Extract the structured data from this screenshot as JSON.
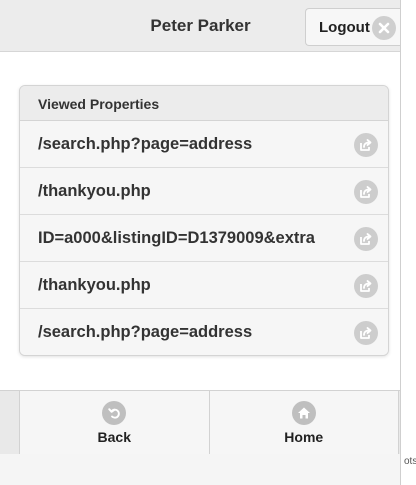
{
  "header": {
    "title": "Peter Parker",
    "logout_label": "Logout",
    "logout_icon": "close-icon"
  },
  "viewed_properties": {
    "heading": "Viewed Properties",
    "items": [
      {
        "label": "/search.php?page=address",
        "icon": "share-icon"
      },
      {
        "label": "/thankyou.php",
        "icon": "share-icon"
      },
      {
        "label": "ID=a000&listingID=D1379009&extra",
        "icon": "share-icon"
      },
      {
        "label": "/thankyou.php",
        "icon": "share-icon"
      },
      {
        "label": "/search.php?page=address",
        "icon": "share-icon"
      }
    ]
  },
  "footer": {
    "back_label": "Back",
    "back_icon": "back-arrow-icon",
    "home_label": "Home",
    "home_icon": "home-icon"
  },
  "edge_text": "ots",
  "colors": {
    "header_bg": "#ececec",
    "icon_gray": "#cdcdcd",
    "text": "#333333"
  }
}
